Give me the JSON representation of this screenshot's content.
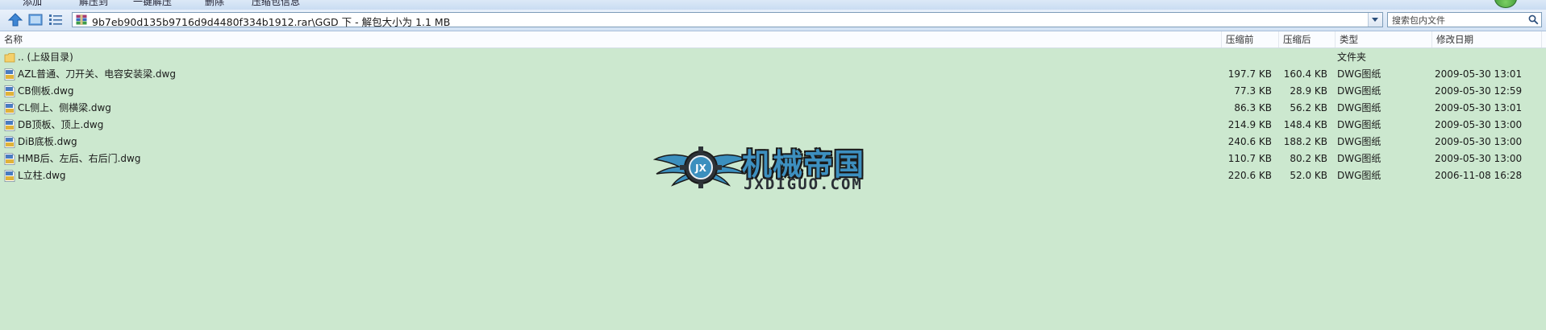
{
  "menu": {
    "items": [
      "添加",
      "解压到",
      "一键解压",
      "删除",
      "压缩包信息"
    ]
  },
  "toolbar": {
    "path": "9b7eb90d135b9716d9d4480f334b1912.rar\\GGD 下 - 解包大小为 1.1 MB",
    "search_placeholder": "搜索包内文件"
  },
  "columns": {
    "name": "名称",
    "packed": "压缩前",
    "unpacked": "压缩后",
    "type": "类型",
    "modified": "修改日期"
  },
  "parent_row": {
    "name": ".. (上级目录)",
    "type": "文件夹"
  },
  "files": [
    {
      "name": "AZL普通、刀开关、电容安装梁.dwg",
      "packed": "197.7 KB",
      "unpacked": "160.4 KB",
      "type": "DWG图纸",
      "modified": "2009-05-30 13:01"
    },
    {
      "name": "CB侧板.dwg",
      "packed": "77.3 KB",
      "unpacked": "28.9 KB",
      "type": "DWG图纸",
      "modified": "2009-05-30 12:59"
    },
    {
      "name": "CL侧上、侧横梁.dwg",
      "packed": "86.3 KB",
      "unpacked": "56.2 KB",
      "type": "DWG图纸",
      "modified": "2009-05-30 13:01"
    },
    {
      "name": "DB顶板、顶上.dwg",
      "packed": "214.9 KB",
      "unpacked": "148.4 KB",
      "type": "DWG图纸",
      "modified": "2009-05-30 13:00"
    },
    {
      "name": "DiB底板.dwg",
      "packed": "240.6 KB",
      "unpacked": "188.2 KB",
      "type": "DWG图纸",
      "modified": "2009-05-30 13:00"
    },
    {
      "name": "HMB后、左后、右后门.dwg",
      "packed": "110.7 KB",
      "unpacked": "80.2 KB",
      "type": "DWG图纸",
      "modified": "2009-05-30 13:00"
    },
    {
      "name": "L立柱.dwg",
      "packed": "220.6 KB",
      "unpacked": "52.0 KB",
      "type": "DWG图纸",
      "modified": "2006-11-08 16:28"
    }
  ],
  "watermark": {
    "title": "机械帝国",
    "domain": "JXDIGUO.COM",
    "emblem_letters": "JX"
  },
  "colors": {
    "background": "#cce8cf",
    "accent": "#3d8fbf"
  }
}
